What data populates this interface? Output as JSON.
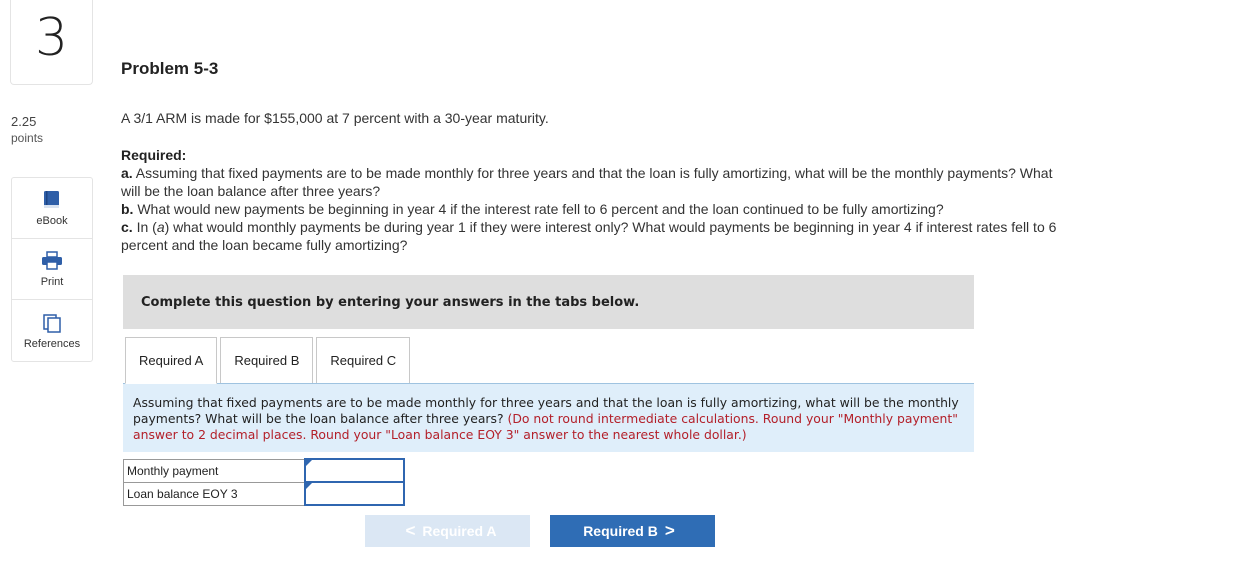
{
  "question": {
    "number": "3",
    "points_value": "2.25",
    "points_label": "points"
  },
  "tools": [
    {
      "label": "eBook",
      "icon": "book-icon"
    },
    {
      "label": "Print",
      "icon": "printer-icon"
    },
    {
      "label": "References",
      "icon": "references-icon"
    }
  ],
  "problem": {
    "title": "Problem 5-3",
    "intro": "A 3/1 ARM is made for $155,000 at 7 percent with a 30-year maturity.",
    "required_heading": "Required:",
    "part_a_label": "a.",
    "part_a_text": " Assuming that fixed payments are to be made monthly for three years and that the loan is fully amortizing, what will be the monthly payments? What will be the loan balance after three years?",
    "part_b_label": "b.",
    "part_b_text": " What would new payments be beginning in year 4 if the interest rate fell to 6 percent and the loan continued to be fully amortizing?",
    "part_c_label": "c.",
    "part_c_text_1": " In (",
    "part_c_italic": "a",
    "part_c_text_2": ") what would monthly payments be during year 1 if they were interest only? What would payments be beginning in year 4 if interest rates fell to 6 percent and the loan became fully amortizing?"
  },
  "complete_bar": "Complete this question by entering your answers in the tabs below.",
  "tabs": [
    {
      "label": "Required A",
      "active": true
    },
    {
      "label": "Required B",
      "active": false
    },
    {
      "label": "Required C",
      "active": false
    }
  ],
  "prompt": {
    "text": "Assuming that fixed payments are to be made monthly for three years and that the loan is fully amortizing, what will be the monthly payments? What will be the loan balance after three years? ",
    "note": "(Do not round intermediate calculations. Round your \"Monthly payment\" answer to 2 decimal places. Round your \"Loan balance EOY 3\" answer to the nearest whole dollar.)"
  },
  "answers": [
    {
      "label": "Monthly payment",
      "value": ""
    },
    {
      "label": "Loan balance EOY 3",
      "value": ""
    }
  ],
  "nav": {
    "prev_label": "Required A",
    "next_label": "Required B",
    "prev_chevron": "<",
    "next_chevron": ">"
  },
  "colors": {
    "accent": "#2f6db5",
    "note_red": "#b3202a",
    "prompt_bg": "#dfeefa",
    "bar_bg": "#dedede"
  }
}
